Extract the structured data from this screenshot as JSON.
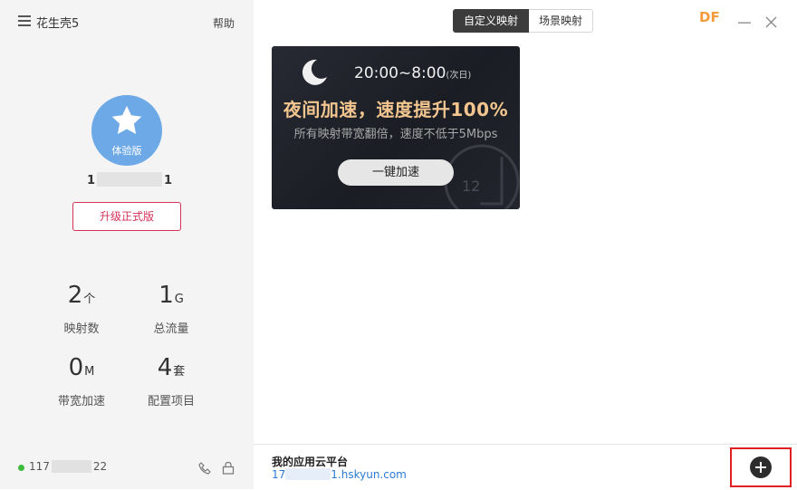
{
  "app": {
    "name": "花生壳5",
    "help": "帮助",
    "brand": "DF"
  },
  "profile": {
    "badge": "体验版",
    "account_prefix": "1",
    "account_suffix": "1",
    "upgrade_label": "升级正式版"
  },
  "stats": [
    {
      "value": "2",
      "unit": "个",
      "label": "映射数"
    },
    {
      "value": "1",
      "unit": "G",
      "label": "总流量"
    },
    {
      "value": "0",
      "unit": "M",
      "label": "带宽加速"
    },
    {
      "value": "4",
      "unit": "套",
      "label": "配置项目"
    }
  ],
  "status": {
    "ip_prefix": "117",
    "ip_suffix": "22",
    "color": "#3dbb3d"
  },
  "tabs": [
    {
      "label": "自定义映射",
      "active": true
    },
    {
      "label": "场景映射",
      "active": false
    }
  ],
  "banner": {
    "time": "20:00~8:00",
    "time_note": "(次日)",
    "headline": "夜间加速，速度提升100%",
    "subline": "所有映射带宽翻倍，速度不低于5Mbps",
    "button": "一键加速",
    "clock_number": "12",
    "headline_color": "#f3c58f"
  },
  "footer": {
    "title": "我的应用云平台",
    "domain_prefix": "17",
    "domain_suffix": "1.hskyun.com",
    "add_icon": "plus-circle-icon"
  },
  "colors": {
    "accent": "#d6335b",
    "avatar": "#6ea9e7",
    "brand": "#f39a3b",
    "highlight": "#e02020"
  }
}
